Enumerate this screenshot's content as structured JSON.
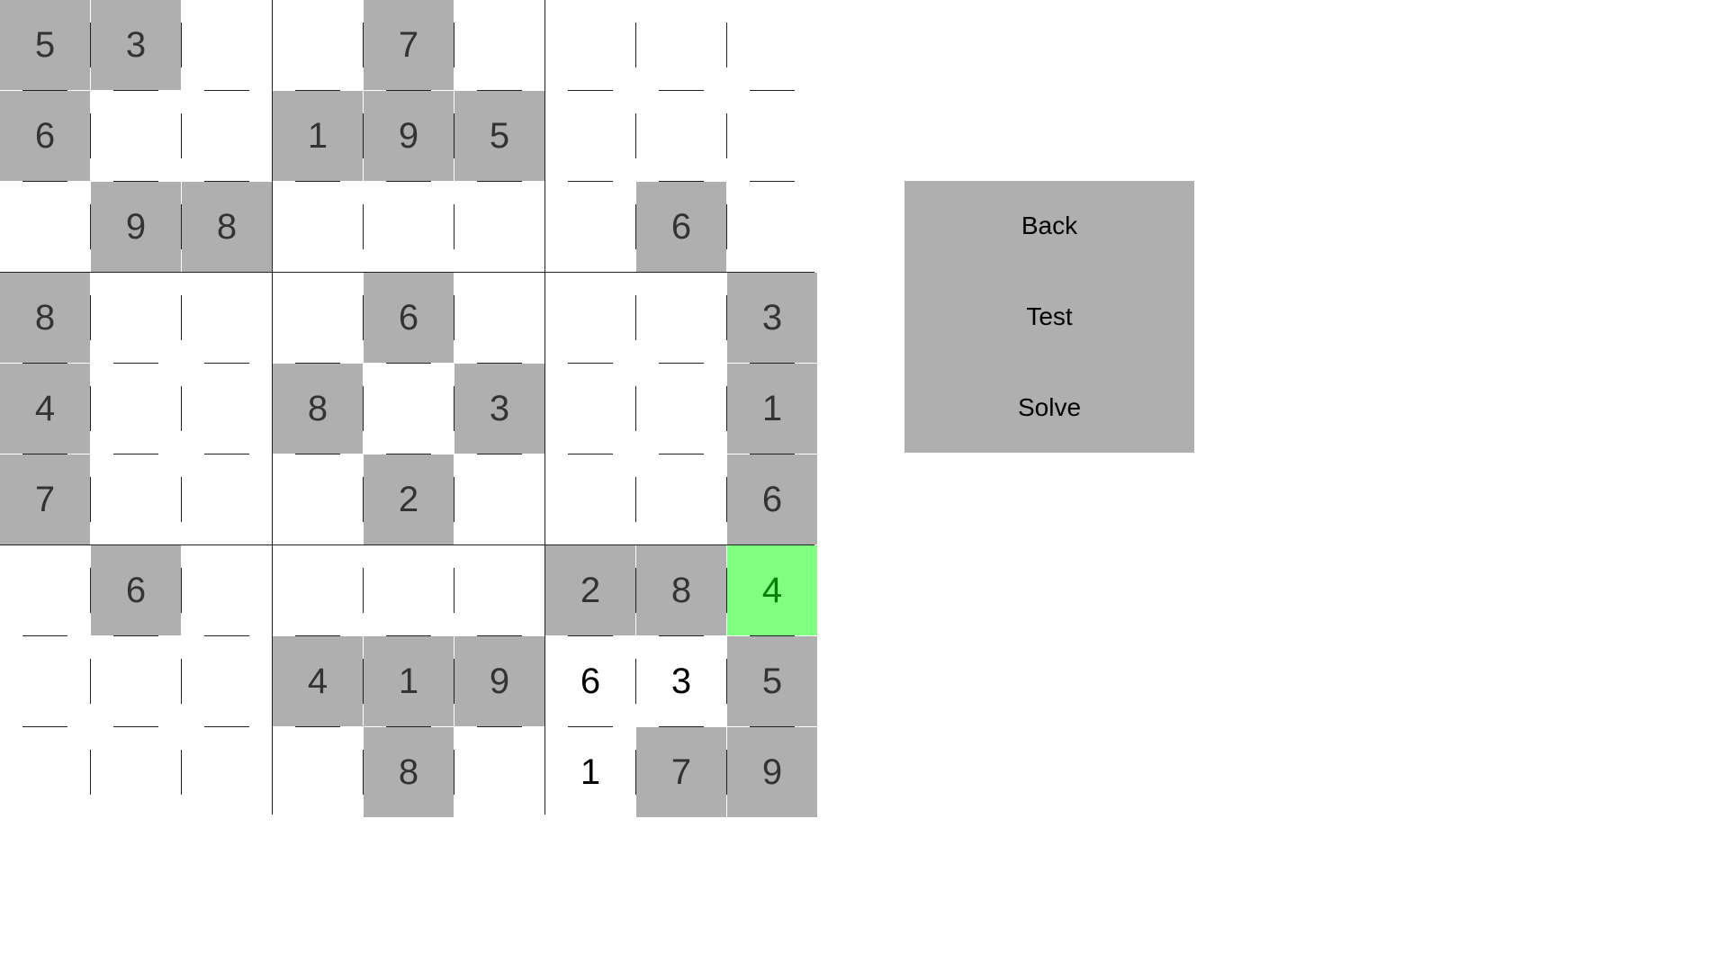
{
  "board": {
    "grid": [
      [
        "5",
        "3",
        "",
        "",
        "7",
        "",
        "",
        "",
        ""
      ],
      [
        "6",
        "",
        "",
        "1",
        "9",
        "5",
        "",
        "",
        ""
      ],
      [
        "",
        "9",
        "8",
        "",
        "",
        "",
        "",
        "6",
        ""
      ],
      [
        "8",
        "",
        "",
        "",
        "6",
        "",
        "",
        "",
        "3"
      ],
      [
        "4",
        "",
        "",
        "8",
        "",
        "3",
        "",
        "",
        "1"
      ],
      [
        "7",
        "",
        "",
        "",
        "2",
        "",
        "",
        "",
        "6"
      ],
      [
        "",
        "6",
        "",
        "",
        "",
        "",
        "2",
        "8",
        "4"
      ],
      [
        "",
        "",
        "",
        "4",
        "1",
        "9",
        "6",
        "3",
        "5"
      ],
      [
        "",
        "",
        "",
        "",
        "8",
        "",
        "1",
        "7",
        "9"
      ]
    ],
    "given": [
      [
        1,
        1,
        0,
        0,
        1,
        0,
        0,
        0,
        0
      ],
      [
        1,
        0,
        0,
        1,
        1,
        1,
        0,
        0,
        0
      ],
      [
        0,
        1,
        1,
        0,
        0,
        0,
        0,
        1,
        0
      ],
      [
        1,
        0,
        0,
        0,
        1,
        0,
        0,
        0,
        1
      ],
      [
        1,
        0,
        0,
        1,
        0,
        1,
        0,
        0,
        1
      ],
      [
        1,
        0,
        0,
        0,
        1,
        0,
        0,
        0,
        1
      ],
      [
        0,
        1,
        0,
        0,
        0,
        0,
        1,
        1,
        0
      ],
      [
        0,
        0,
        0,
        1,
        1,
        1,
        0,
        0,
        1
      ],
      [
        0,
        0,
        0,
        0,
        1,
        0,
        0,
        1,
        1
      ]
    ],
    "selected": {
      "row": 6,
      "col": 8
    },
    "colors": {
      "given_bg": "#afafaf",
      "selected_bg": "#80ff80",
      "selected_text": "#007f00",
      "grid_line": "#222222"
    }
  },
  "controls": {
    "back_label": "Back",
    "test_label": "Test",
    "solve_label": "Solve"
  }
}
